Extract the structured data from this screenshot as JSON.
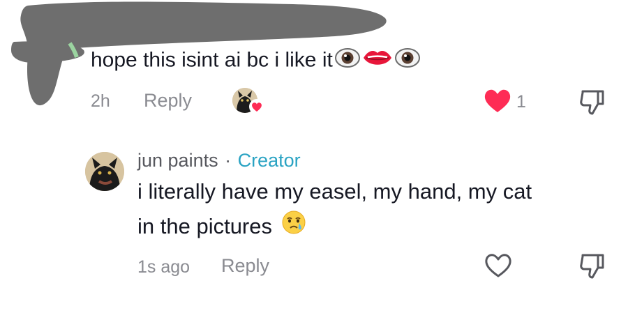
{
  "comment": {
    "text": "hope this isint ai bc i like it",
    "emojis": [
      "eye-emoji",
      "lips-emoji",
      "eye-emoji"
    ],
    "time": "2h",
    "reply_label": "Reply",
    "like_count": "1",
    "liked_by_creator": true,
    "like_color": "#fe2c55"
  },
  "reply": {
    "username": "jun paints",
    "separator": "·",
    "badge": "Creator",
    "text_line1": "i literally have my easel, my hand, my cat",
    "text_line2": "in the pictures",
    "emoji": "holding-back-tears-emoji",
    "time": "1s ago",
    "reply_label": "Reply",
    "creator_color": "#2aa3c3"
  }
}
